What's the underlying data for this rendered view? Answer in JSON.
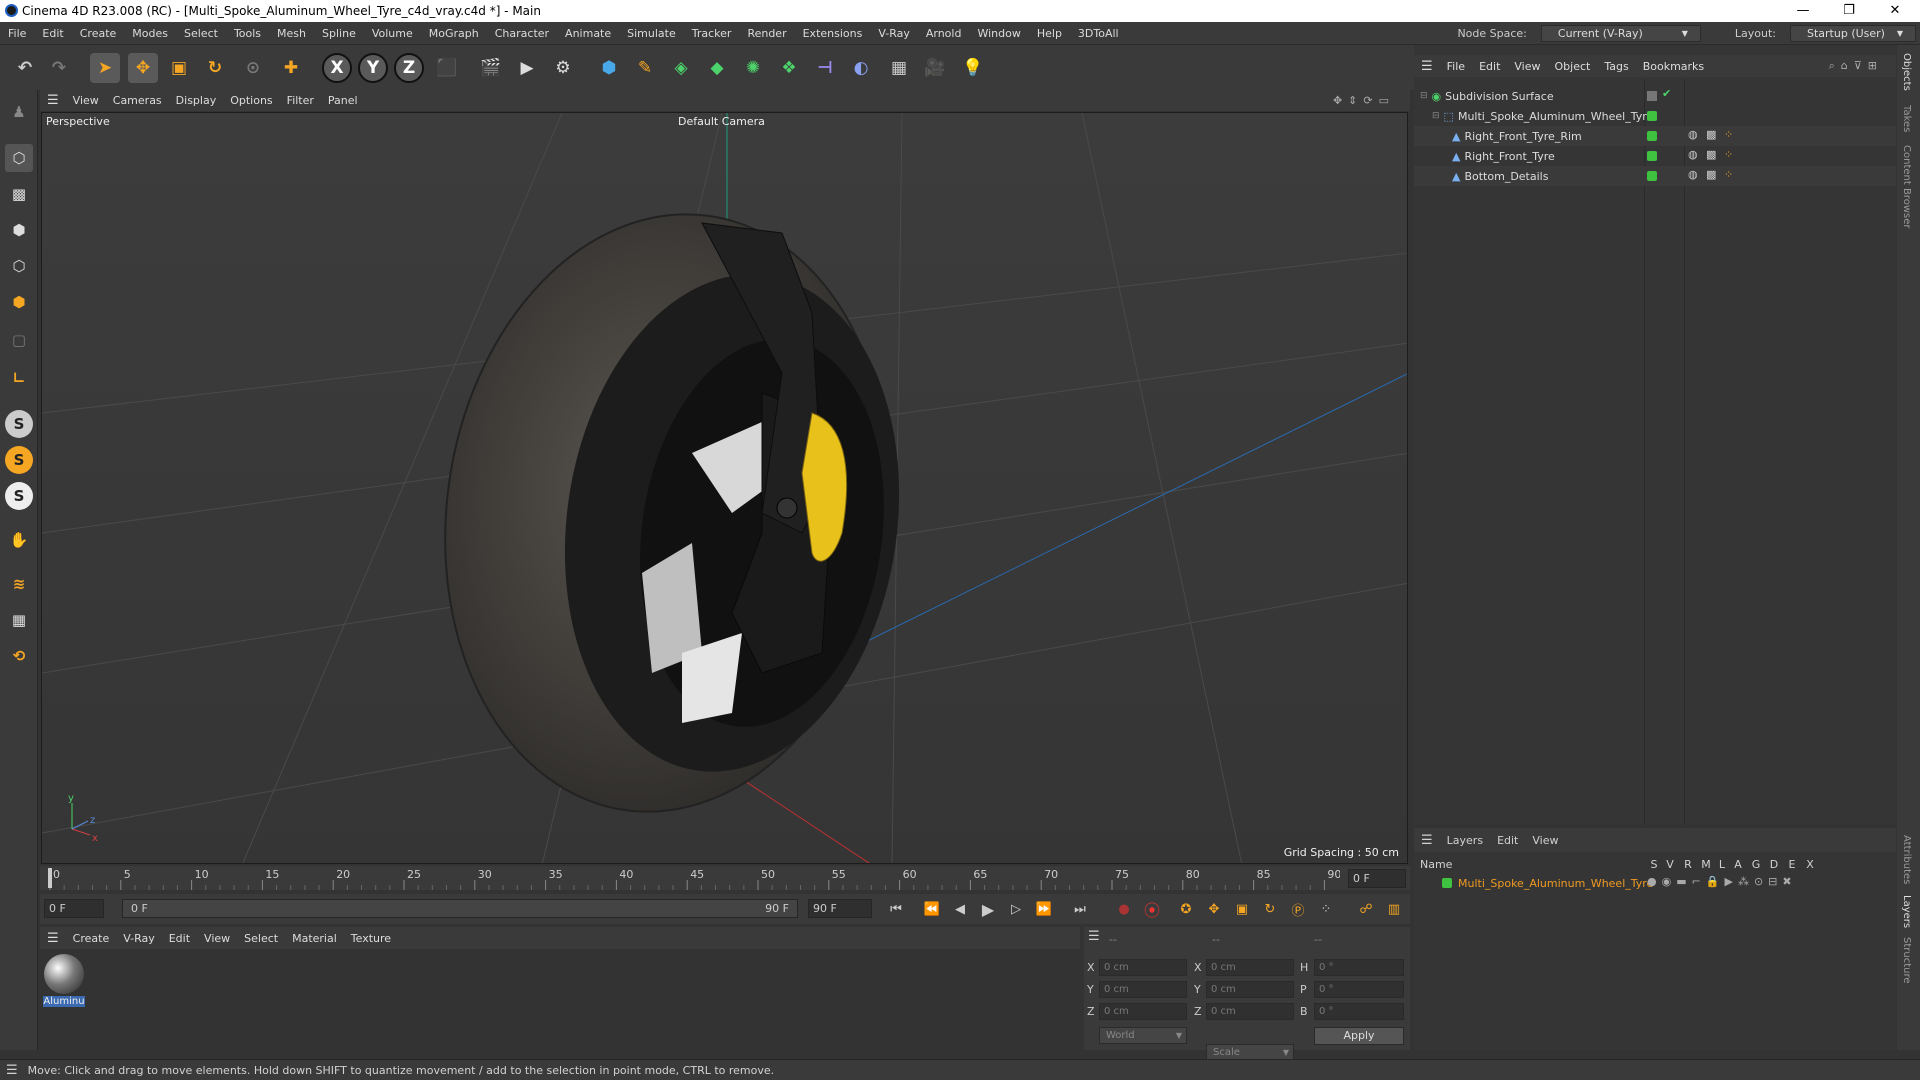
{
  "window": {
    "title": "Cinema 4D R23.008 (RC) - [Multi_Spoke_Aluminum_Wheel_Tyre_c4d_vray.c4d *] - Main"
  },
  "menu": [
    "File",
    "Edit",
    "Create",
    "Modes",
    "Select",
    "Tools",
    "Mesh",
    "Spline",
    "Volume",
    "MoGraph",
    "Character",
    "Animate",
    "Simulate",
    "Tracker",
    "Render",
    "Extensions",
    "V-Ray",
    "Arnold",
    "Window",
    "Help",
    "3DToAll"
  ],
  "nodespace": {
    "label": "Node Space:",
    "value": "Current (V-Ray)",
    "layout_label": "Layout:",
    "layout_value": "Startup (User)"
  },
  "viewport": {
    "menu": [
      "View",
      "Cameras",
      "Display",
      "Options",
      "Filter",
      "Panel"
    ],
    "view_name": "Perspective",
    "camera": "Default Camera",
    "grid_spacing": "Grid Spacing : 50 cm"
  },
  "timeline": {
    "ticks": [
      "0",
      "5",
      "10",
      "15",
      "20",
      "25",
      "30",
      "35",
      "40",
      "45",
      "50",
      "55",
      "60",
      "65",
      "70",
      "75",
      "80",
      "85",
      "90"
    ],
    "current": "0 F"
  },
  "transport": {
    "start": "0 F",
    "range_start": "0 F",
    "range_end": "90 F",
    "end": "90 F"
  },
  "material_menu": [
    "Create",
    "V-Ray",
    "Edit",
    "View",
    "Select",
    "Material",
    "Texture"
  ],
  "material": {
    "name": "Aluminu"
  },
  "coords": {
    "head1": "--",
    "head2": "--",
    "head3": "--",
    "rows": [
      {
        "a": "X",
        "av": "0 cm",
        "b": "X",
        "bv": "0 cm",
        "c": "H",
        "cv": "0 °"
      },
      {
        "a": "Y",
        "av": "0 cm",
        "b": "Y",
        "bv": "0 cm",
        "c": "P",
        "cv": "0 °"
      },
      {
        "a": "Z",
        "av": "0 cm",
        "b": "Z",
        "bv": "0 cm",
        "c": "B",
        "cv": "0 °"
      }
    ],
    "world": "World",
    "scale": "Scale",
    "apply": "Apply"
  },
  "objects": {
    "menu": [
      "File",
      "Edit",
      "View",
      "Object",
      "Tags",
      "Bookmarks"
    ],
    "items": [
      {
        "name": "Subdivision Surface"
      },
      {
        "name": "Multi_Spoke_Aluminum_Wheel_Tyre"
      },
      {
        "name": "Right_Front_Tyre_Rim"
      },
      {
        "name": "Right_Front_Tyre"
      },
      {
        "name": "Bottom_Details"
      }
    ]
  },
  "layers": {
    "menu": [
      "Layers",
      "Edit",
      "View"
    ],
    "col_name": "Name",
    "cols": [
      "S",
      "V",
      "R",
      "M",
      "L",
      "A",
      "G",
      "D",
      "E",
      "X"
    ],
    "row": "Multi_Spoke_Aluminum_Wheel_Tyre"
  },
  "side_tabs": [
    "Objects",
    "Takes",
    "Content Browser",
    "Attributes",
    "Layers",
    "Structure"
  ],
  "status": "Move: Click and drag to move elements. Hold down SHIFT to quantize movement / add to the selection in point mode, CTRL to remove.",
  "colors": {
    "accent": "#f5a623",
    "green": "#3fc23f",
    "layer_text": "#f09a22"
  }
}
